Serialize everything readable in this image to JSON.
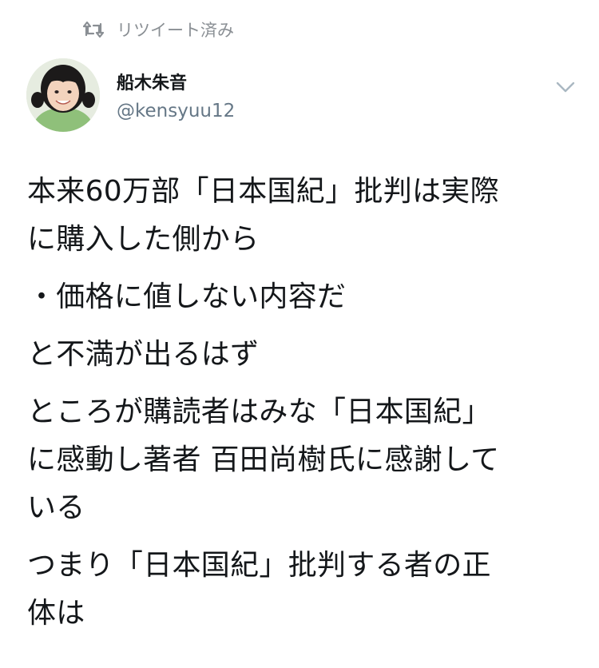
{
  "retweet": {
    "icon": "retweet-icon",
    "label": "リツイート済み"
  },
  "author": {
    "display_name": "船木朱音",
    "handle": "@kensyuu12",
    "avatar_icon": "avatar-photo"
  },
  "menu": {
    "icon": "chevron-down-icon"
  },
  "tweet": {
    "paragraphs": [
      "本来60万部「日本国紀」批判は実際\nに購入した側から",
      "・価格に値しない内容だ",
      "と不満が出るはず",
      "ところが購読者はみな「日本国紀」\nに感動し著者 百田尚樹氏に感謝して\nいる",
      "つまり「日本国紀」批判する者の正\n体は"
    ]
  },
  "colors": {
    "text": "#14171a",
    "muted": "#657786",
    "retweet_gray": "#8a8f94",
    "avatar_shirt": "#8fc07a"
  }
}
